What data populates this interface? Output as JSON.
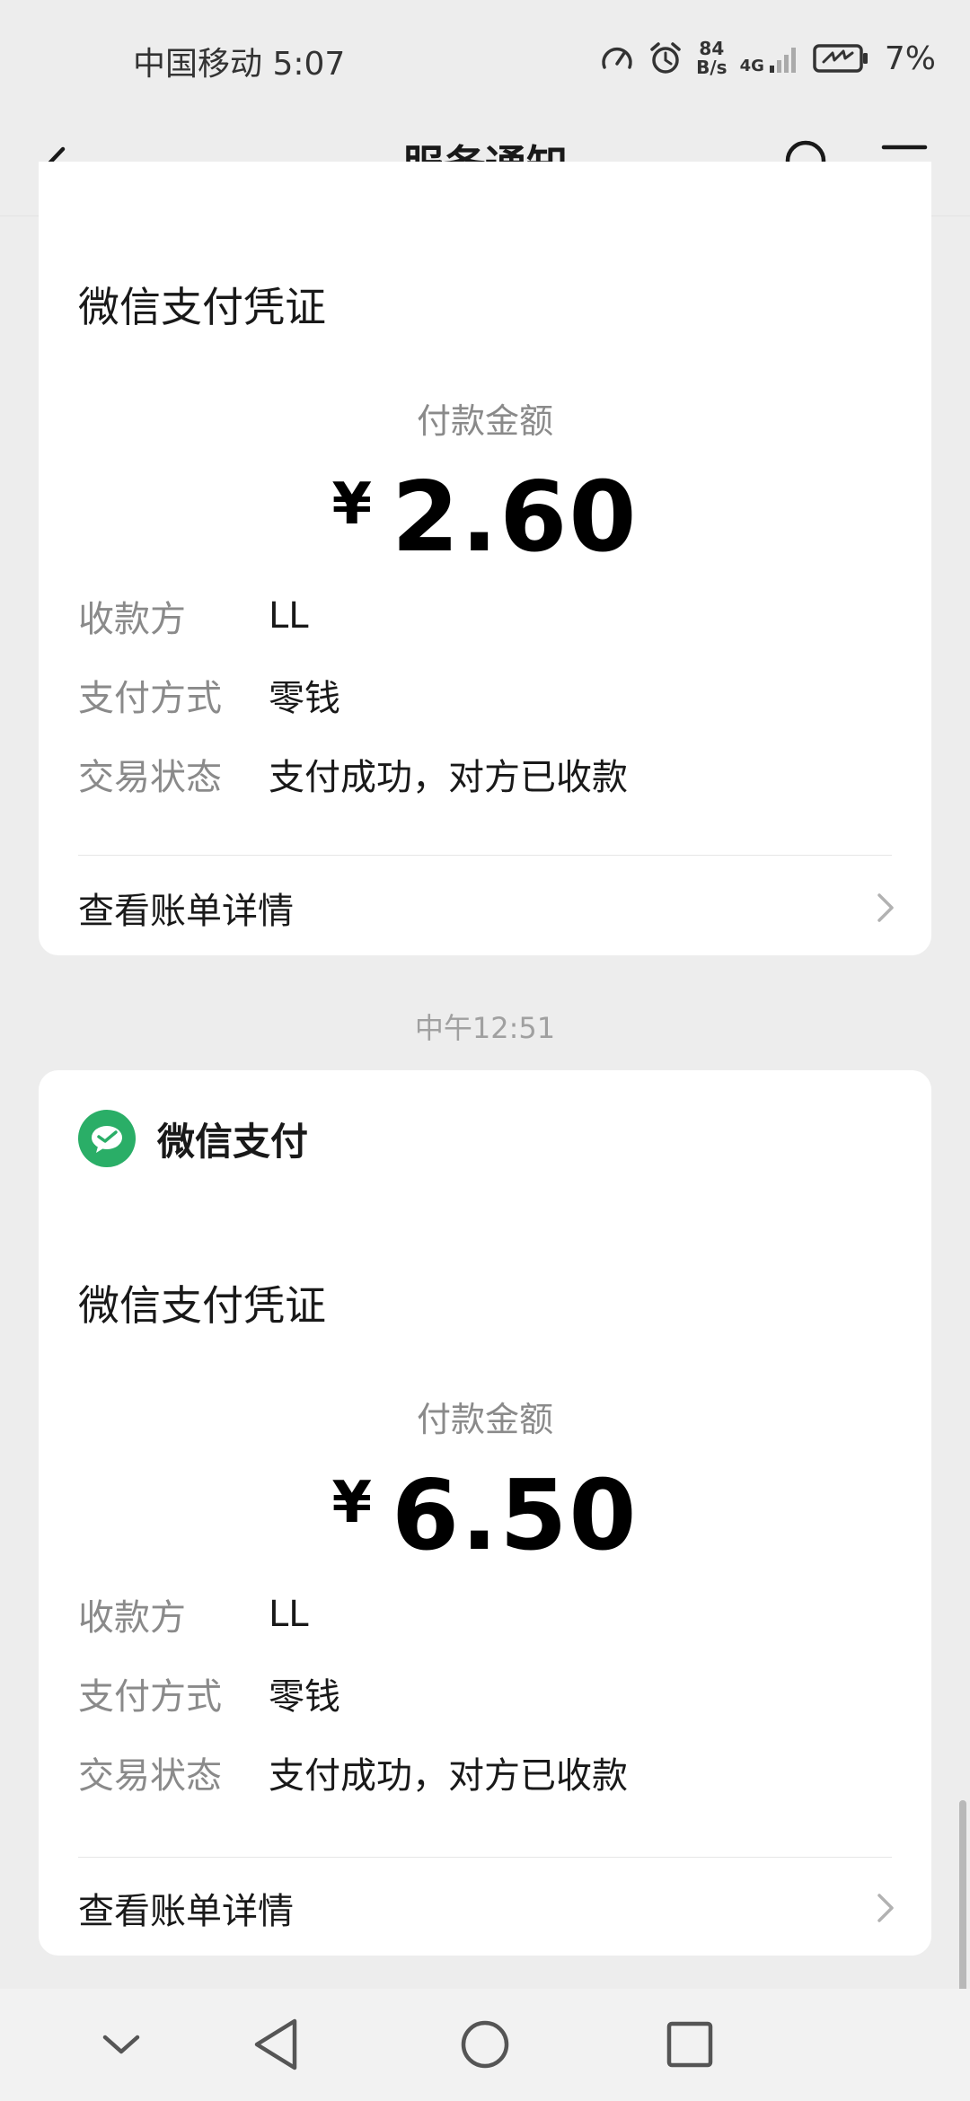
{
  "status_bar": {
    "carrier_time": "中国移动 5:07",
    "net_speed_value": "84",
    "net_speed_unit": "B/s",
    "network_type": "4G",
    "battery_percent": "7%",
    "icons": [
      "speed-gauge-icon",
      "alarm-icon",
      "signal-icon",
      "battery-saver-icon"
    ]
  },
  "nav": {
    "title": "服务通知",
    "icons": [
      "chevron-left-icon",
      "search-icon",
      "menu-icon"
    ]
  },
  "cards": [
    {
      "voucher_title": "微信支付凭证",
      "amount_label": "付款金额",
      "currency": "¥",
      "amount": "2.60",
      "rows": [
        {
          "key": "收款方",
          "value": "LL"
        },
        {
          "key": "支付方式",
          "value": "零钱"
        },
        {
          "key": "交易状态",
          "value": "支付成功，对方已收款"
        }
      ],
      "link": "查看账单详情"
    },
    {
      "app_name": "微信支付",
      "voucher_title": "微信支付凭证",
      "amount_label": "付款金额",
      "currency": "¥",
      "amount": "6.50",
      "rows": [
        {
          "key": "收款方",
          "value": "LL"
        },
        {
          "key": "支付方式",
          "value": "零钱"
        },
        {
          "key": "交易状态",
          "value": "支付成功，对方已收款"
        }
      ],
      "link": "查看账单详情"
    }
  ],
  "timestamp": "中午12:51",
  "colors": {
    "background": "#ededed",
    "card": "#ffffff",
    "wechat_pay_green": "#2aae67",
    "muted_text": "#8a8a8a"
  }
}
